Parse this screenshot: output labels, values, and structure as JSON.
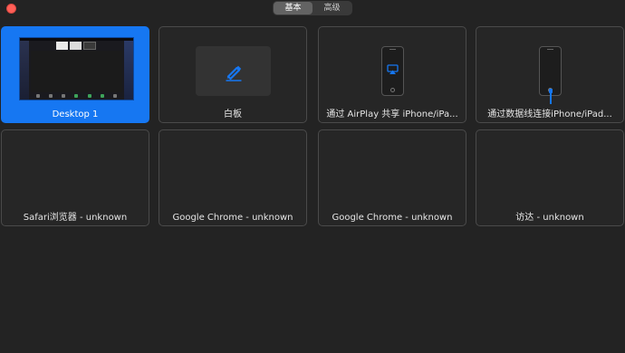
{
  "window": {
    "close_icon": "close-dot"
  },
  "tabs": [
    {
      "label": "基本",
      "active": true
    },
    {
      "label": "高级",
      "active": false
    }
  ],
  "tiles": [
    {
      "label": "Desktop 1",
      "selected": true,
      "icon": "desktop-thumbnail"
    },
    {
      "label": "白板",
      "selected": false,
      "icon": "pencil-icon"
    },
    {
      "label": "通过 AirPlay 共享 iPhone/iPa...",
      "selected": false,
      "icon": "airplay-icon"
    },
    {
      "label": "通过数据线连接iPhone/iPad...",
      "selected": false,
      "icon": "phone-cable-icon"
    },
    {
      "label": "Safari浏览器 - unknown",
      "selected": false
    },
    {
      "label": "Google Chrome - unknown",
      "selected": false
    },
    {
      "label": "Google Chrome - unknown",
      "selected": false
    },
    {
      "label": "访达 - unknown",
      "selected": false
    }
  ],
  "colors": {
    "accent": "#1677f2",
    "background": "#232323",
    "tile_border": "#4a4a4a"
  }
}
